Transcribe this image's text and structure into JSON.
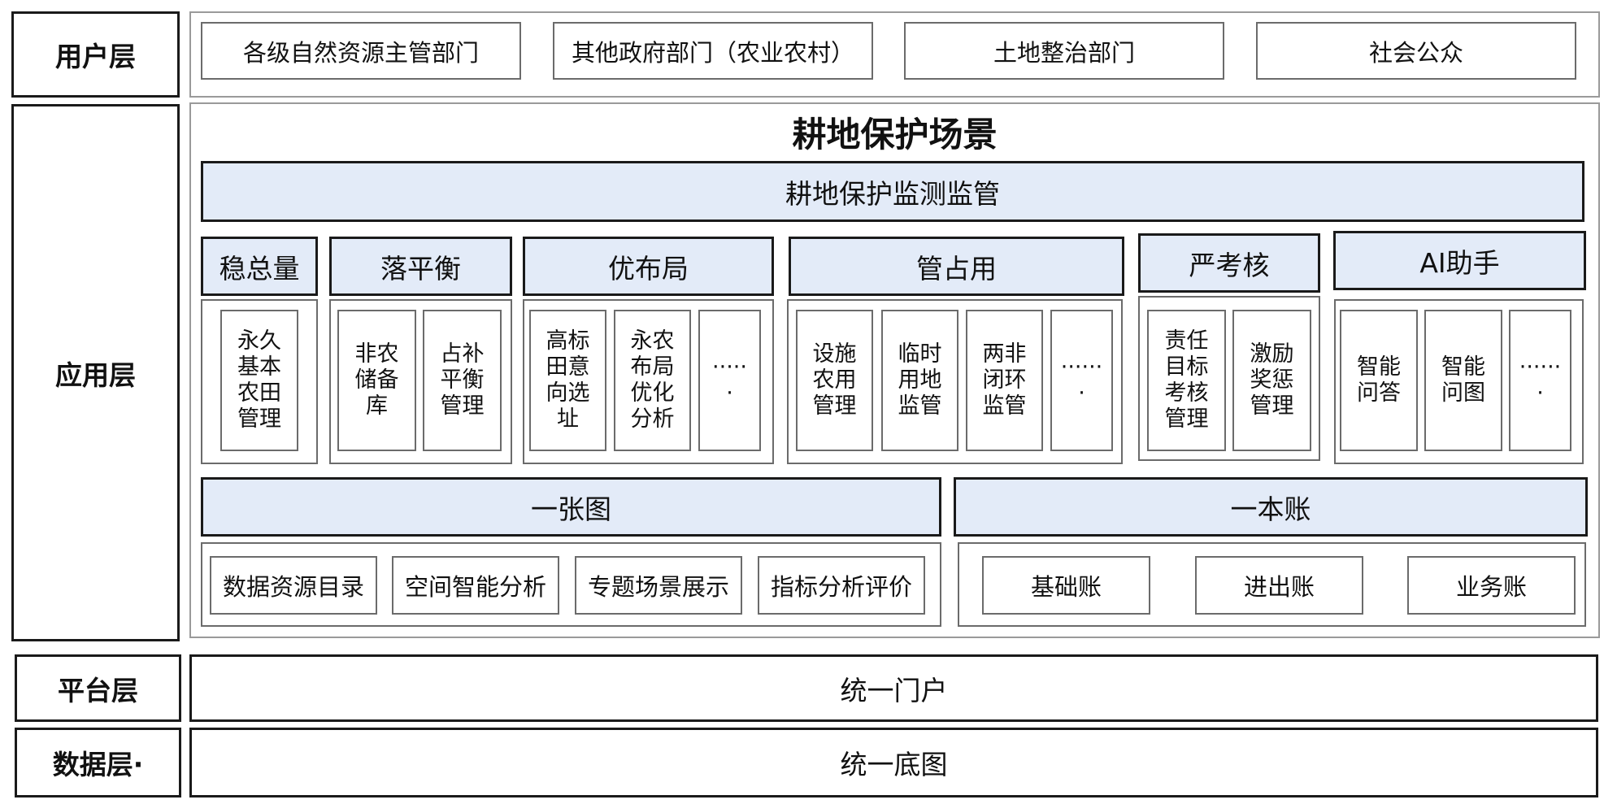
{
  "layers": {
    "user": "用户层",
    "application": "应用层",
    "platform": "平台层",
    "data": "数据层·"
  },
  "user_layer": {
    "items": [
      "各级自然资源主管部门",
      "其他政府部门（农业农村）",
      "土地整治部门",
      "社会公众"
    ]
  },
  "application_layer": {
    "title": "耕地保护场景",
    "monitoring_bar": "耕地保护监测监管",
    "groups": [
      {
        "title": "稳总量",
        "items": [
          "永久\n基本\n农田\n管理"
        ]
      },
      {
        "title": "落平衡",
        "items": [
          "非农\n储备\n库",
          "占补\n平衡\n管理"
        ]
      },
      {
        "title": "优布局",
        "items": [
          "高标\n田意\n向选\n址",
          "永农\n布局\n优化\n分析",
          "·····\n·"
        ]
      },
      {
        "title": "管占用",
        "items": [
          "设施\n农用\n管理",
          "临时\n用地\n监管",
          "两非\n闭环\n监管",
          "······\n·"
        ]
      },
      {
        "title": "严考核",
        "items": [
          "责任\n目标\n考核\n管理",
          "激励\n奖惩\n管理"
        ]
      },
      {
        "title": "AI助手",
        "items": [
          "智能\n问答",
          "智能\n问图",
          "······\n·"
        ]
      }
    ],
    "map": {
      "title": "一张图",
      "items": [
        "数据资源目录",
        "空间智能分析",
        "专题场景展示",
        "指标分析评价"
      ]
    },
    "ledger": {
      "title": "一本账",
      "items": [
        "基础账",
        "进出账",
        "业务账"
      ]
    }
  },
  "platform_layer": {
    "portal": "统一门户"
  },
  "data_layer": {
    "basemap": "统一底图"
  }
}
